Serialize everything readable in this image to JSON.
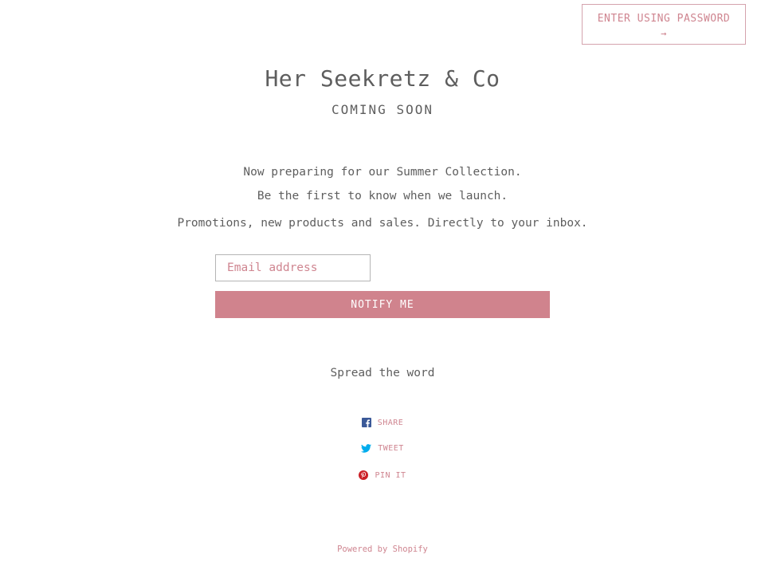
{
  "header": {
    "password_button": {
      "label": "ENTER USING PASSWORD",
      "arrow": "→"
    }
  },
  "hero": {
    "title": "Her Seekretz & Co",
    "subtitle": "COMING SOON"
  },
  "messages": [
    "Now preparing for our Summer Collection.",
    "Be the first to know when we launch.",
    "Promotions, new products and sales. Directly to your inbox."
  ],
  "signup": {
    "email_placeholder": "Email address",
    "email_value": "",
    "submit_label": "NOTIFY ME"
  },
  "share": {
    "heading": "Spread the word",
    "items": [
      {
        "label": "SHARE",
        "icon": "facebook-icon",
        "color": "#3b5998"
      },
      {
        "label": "TWEET",
        "icon": "twitter-icon",
        "color": "#00aced"
      },
      {
        "label": "PIN IT",
        "icon": "pinterest-icon",
        "color": "#cb2027"
      }
    ]
  },
  "footer": {
    "powered_by": "Powered by Shopify"
  },
  "colors": {
    "accent": "#d0838d",
    "text": "#5e5e5e",
    "link": "#cf8590"
  }
}
